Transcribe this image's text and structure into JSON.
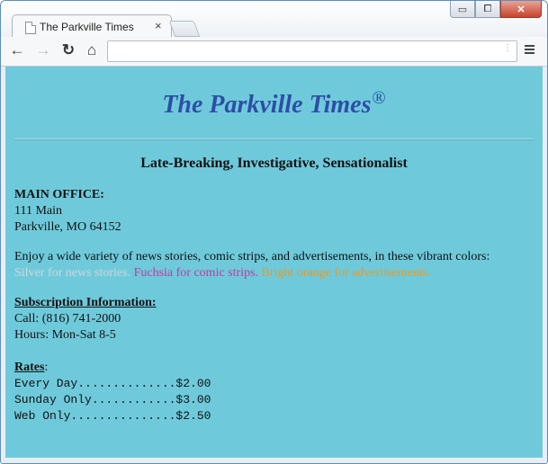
{
  "browser": {
    "tab_title": "The Parkville Times",
    "tab_close": "×",
    "window_buttons": {
      "minimize": "▭",
      "maximize": "⧠",
      "close": "✕"
    },
    "toolbar": {
      "back": "←",
      "forward": "→",
      "reload": "↻",
      "home": "⌂",
      "address": ""
    },
    "icons": [
      "page-icon",
      "back-icon",
      "forward-icon",
      "reload-icon",
      "home-icon",
      "menu-icon"
    ]
  },
  "page": {
    "background_color": "#6ecadb",
    "masthead": {
      "title": "The Parkville Times",
      "registered": "®",
      "color": "#2e4ea5"
    },
    "tagline": "Late-Breaking, Investigative, Sensationalist",
    "office": {
      "heading": "MAIN OFFICE:",
      "street": "111 Main",
      "city": "Parkville, MO 64152"
    },
    "colors_intro": "Enjoy a wide variety of news stories, comic strips, and advertisements, in these vibrant colors:",
    "colors": {
      "silver": "Silver for news stories.",
      "fuchsia": "Fuchsia for comic strips.",
      "orange": "Bright orange for advertisements."
    },
    "subscription": {
      "heading": "Subscription Information:",
      "call": "Call: (816) 741-2000",
      "hours": "Hours: Mon-Sat 8-5"
    },
    "rates": {
      "heading": "Rates",
      "colon": ":",
      "lines": [
        "Every Day..............$2.00",
        "Sunday Only............$3.00",
        "Web Only...............$2.50"
      ]
    }
  }
}
